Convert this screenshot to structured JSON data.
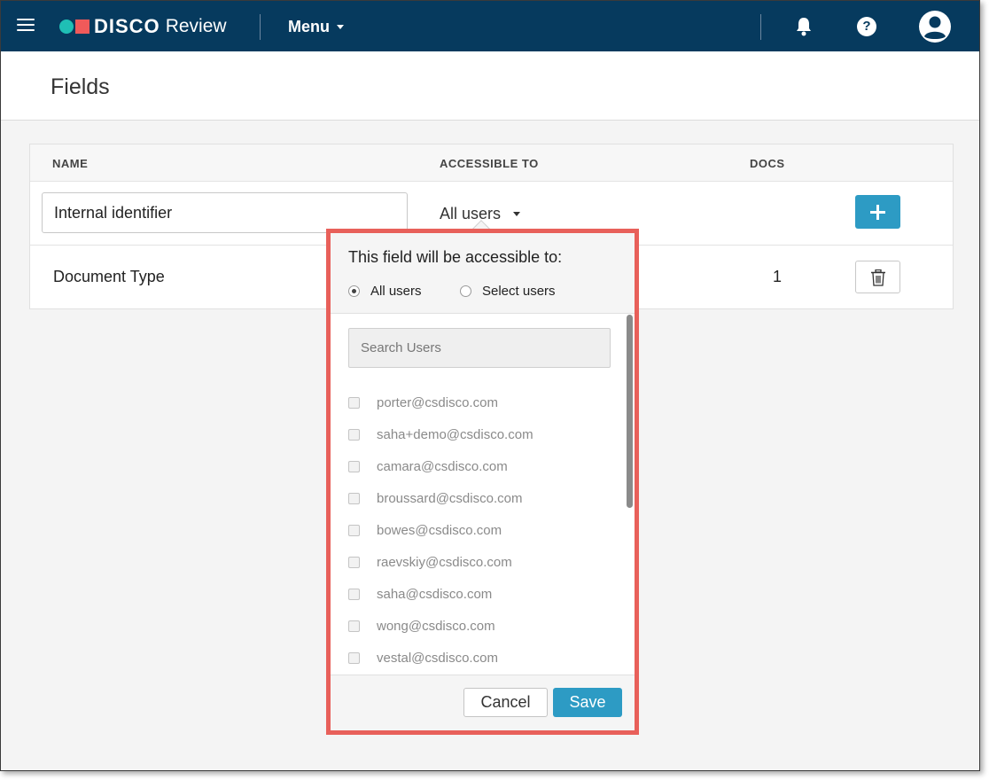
{
  "app": {
    "logo_brand": "DISCO",
    "logo_product": "Review",
    "menu_label": "Menu",
    "icons": {
      "hamburger": "hamburger-icon",
      "notifications": "bell-icon",
      "help": "question-icon",
      "help_glyph": "?",
      "account": "user-avatar-icon"
    },
    "colors": {
      "topbar": "#063a5e",
      "accent": "#2d9bc4",
      "logo_dot": "#1fbfb5",
      "logo_square": "#f05a5a",
      "highlight_border": "#e8605a"
    }
  },
  "page": {
    "title": "Fields"
  },
  "table": {
    "headers": {
      "name": "NAME",
      "accessible_to": "ACCESSIBLE TO",
      "docs": "DOCS"
    },
    "new_row": {
      "name_value": "Internal identifier",
      "accessible_value": "All users"
    },
    "rows": [
      {
        "name": "Document Type",
        "docs": "1"
      }
    ]
  },
  "popover": {
    "title": "This field will be accessible to:",
    "options": [
      {
        "label": "All users",
        "selected": true
      },
      {
        "label": "Select users",
        "selected": false
      }
    ],
    "search_placeholder": "Search Users",
    "users": [
      "porter@csdisco.com",
      "saha+demo@csdisco.com",
      "camara@csdisco.com",
      "broussard@csdisco.com",
      "bowes@csdisco.com",
      "raevskiy@csdisco.com",
      "saha@csdisco.com",
      "wong@csdisco.com",
      "vestal@csdisco.com"
    ],
    "cancel_label": "Cancel",
    "save_label": "Save"
  }
}
